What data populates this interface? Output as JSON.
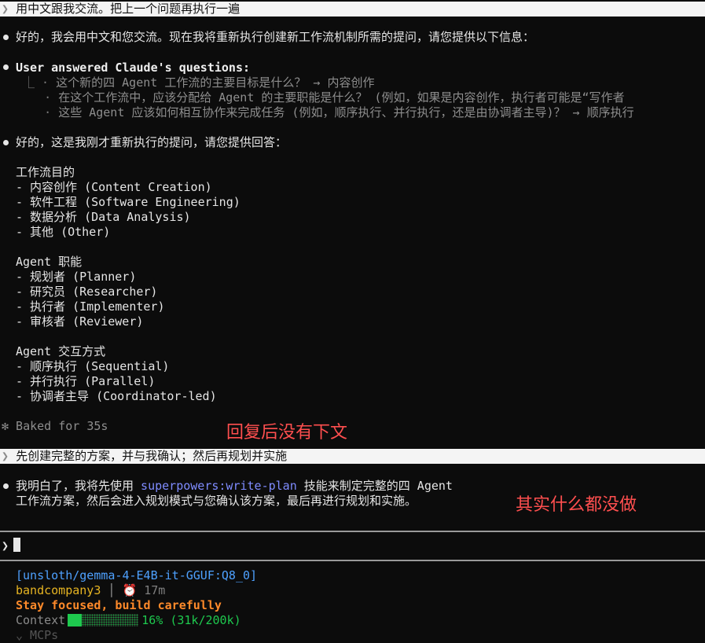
{
  "turn1": {
    "prompt": "用中文跟我交流。把上一个问题再执行一遍",
    "reply": "好的，我会用中文和您交流。现在我将重新执行创建新工作流机制所需的提问，请您提供以下信息：",
    "answered_header": "User answered Claude's questions:",
    "qa": [
      {
        "q": "这个新的四 Agent 工作流的主要目标是什么？",
        "a": "内容创作"
      },
      {
        "q": "在这个工作流中，应该分配给 Agent 的主要职能是什么？ (例如，如果是内容创作，执行者可能是“写作者",
        "a": ""
      },
      {
        "q": "这些 Agent 应该如何相互协作来完成任务 (例如，顺序执行、并行执行，还是由协调者主导)？",
        "a": "顺序执行"
      }
    ],
    "intro": "好的，这是我刚才重新执行的提问，请您提供回答：",
    "sections": [
      {
        "title": "工作流目的",
        "items": [
          "- 内容创作 (Content Creation)",
          "- 软件工程 (Software Engineering)",
          "- 数据分析 (Data Analysis)",
          "- 其他 (Other)"
        ]
      },
      {
        "title": "Agent 职能",
        "items": [
          "- 规划者 (Planner)",
          "- 研究员 (Researcher)",
          "- 执行者 (Implementer)",
          "- 审核者 (Reviewer)"
        ]
      },
      {
        "title": "Agent 交互方式",
        "items": [
          "- 顺序执行 (Sequential)",
          "- 并行执行 (Parallel)",
          "- 协调者主导 (Coordinator-led)"
        ]
      }
    ],
    "status": "✻ Baked for 35s"
  },
  "annotations": {
    "note1": "回复后没有下文",
    "note2": "其实什么都没做"
  },
  "turn2": {
    "prompt": "先创建完整的方案，并与我确认；然后再规划并实施",
    "reply_pre": "我明白了，我将先使用 ",
    "skill": "superpowers:write-plan",
    "reply_post": " 技能来制定完整的四 Agent",
    "reply_line2": "工作流方案，然后会进入规划模式与您确认该方案，最后再进行规划和实施。"
  },
  "input": {
    "prompt_symbol": "❯",
    "value": ""
  },
  "statusline": {
    "model": "[unsloth/gemma-4-E4B-it-GGUF:Q8_0]",
    "user": "bandcompany3",
    "separator": "│",
    "timer_icon": "⏰",
    "elapsed": "17m",
    "motto": "Stay focused, build carefully",
    "context_label": "Context",
    "context_fraction": 0.16,
    "context_text": "16% (31k/200k)",
    "mcp_partial": "⌄ MCPs"
  },
  "colors": {
    "accent_skill": "#7f8cff",
    "annotation": "#ff4f4f",
    "model": "#4ea1ff",
    "user": "#e6b422",
    "motto": "#ff8a2a",
    "context": "#1ec94e"
  }
}
